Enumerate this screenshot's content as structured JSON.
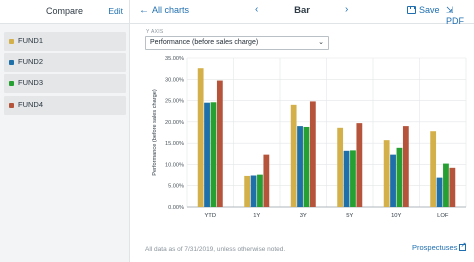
{
  "sidebar": {
    "title": "Compare",
    "edit_label": "Edit",
    "funds": [
      {
        "label": "FUND1",
        "color": "#d4b04a"
      },
      {
        "label": "FUND2",
        "color": "#1f6fa8"
      },
      {
        "label": "FUND3",
        "color": "#27a033"
      },
      {
        "label": "FUND4",
        "color": "#b5543a"
      }
    ]
  },
  "topbar": {
    "back_label": "All charts",
    "chart_type": "Bar",
    "save_label": "Save",
    "pdf_label": "PDF",
    "prev_icon": "chevron-left-icon",
    "next_icon": "chevron-right-icon"
  },
  "axis_selector": {
    "label": "Y AXIS",
    "selected": "Performance (before sales charge)"
  },
  "chart_data": {
    "type": "bar",
    "ylabel": "Performance (before sales charge)",
    "xlabel": "",
    "title": "",
    "ylim": [
      0,
      35
    ],
    "yticks": [
      "0.00%",
      "5.00%",
      "10.00%",
      "15.00%",
      "20.00%",
      "25.00%",
      "30.00%",
      "35.00%"
    ],
    "categories": [
      "YTD",
      "1Y",
      "3Y",
      "5Y",
      "10Y",
      "LOF"
    ],
    "grid": true,
    "series": [
      {
        "name": "FUND1",
        "color": "#d4b04a",
        "values": [
          32.6,
          7.3,
          24.0,
          18.6,
          15.7,
          17.8
        ]
      },
      {
        "name": "FUND2",
        "color": "#1f6fa8",
        "values": [
          24.5,
          7.4,
          19.0,
          13.2,
          12.3,
          6.9
        ]
      },
      {
        "name": "FUND3",
        "color": "#27a033",
        "values": [
          24.6,
          7.6,
          18.8,
          13.3,
          13.9,
          10.2
        ]
      },
      {
        "name": "FUND4",
        "color": "#b5543a",
        "values": [
          29.7,
          12.3,
          24.8,
          19.7,
          19.0,
          9.2
        ]
      }
    ]
  },
  "footer": {
    "note": "All data as of 7/31/2019, unless otherwise noted.",
    "prospectuses_label": "Prospectuses"
  }
}
